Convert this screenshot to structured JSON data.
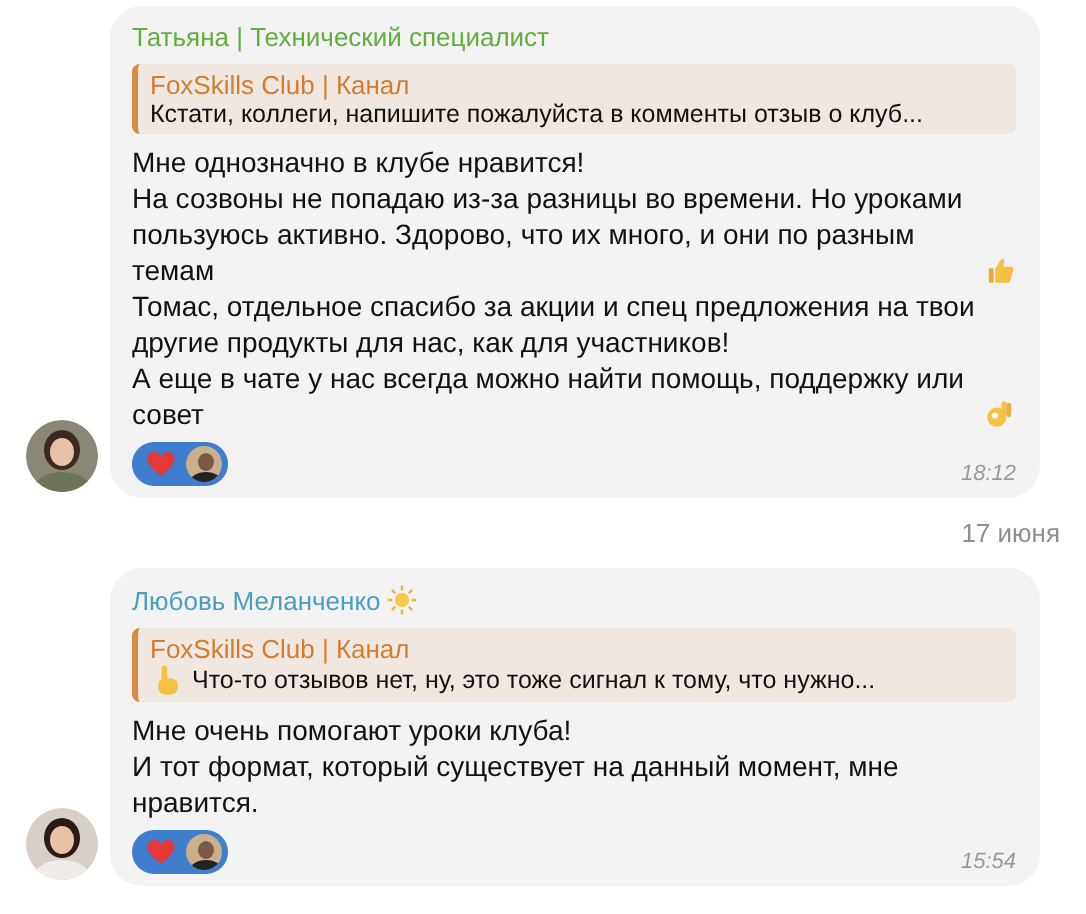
{
  "messages": [
    {
      "kind": "message",
      "author": "Татьяна | Технический специалист",
      "color": "#5fae3e",
      "reply": {
        "title": "FoxSkills Club | Канал",
        "text": "Кстати, коллеги, напишите пожалуйста в комменты отзыв о клуб..."
      },
      "paragraphs": [
        "Мне однозначно в клубе нравится!",
        "На созвоны не попадаю из-за разницы во времени. Но уроками пользуюсь активно. Здорово, что их много, и они по разным темам",
        "Томас, отдельное спасибо за акции и спец предложения на твои другие продукты для нас, как для участников!",
        "А еще в чате у нас всегда можно найти помощь, поддержку или совет"
      ],
      "reactions": [
        {
          "kind": "heart"
        }
      ],
      "time": "18:12"
    },
    {
      "kind": "date",
      "text": "17 июня"
    },
    {
      "kind": "message",
      "author": "Любовь Меланченко",
      "color": "#4a9ec0",
      "reply": {
        "title": "FoxSkills Club | Канал",
        "text": "Что-то отзывов нет, ну, это тоже сигнал к тому, что нужно..."
      },
      "paragraphs": [
        "Мне очень помогают уроки клуба!",
        "И тот формат, который существует на данный момент, мне нравится."
      ],
      "reactions": [
        {
          "kind": "heart"
        }
      ],
      "time": "15:54"
    }
  ]
}
